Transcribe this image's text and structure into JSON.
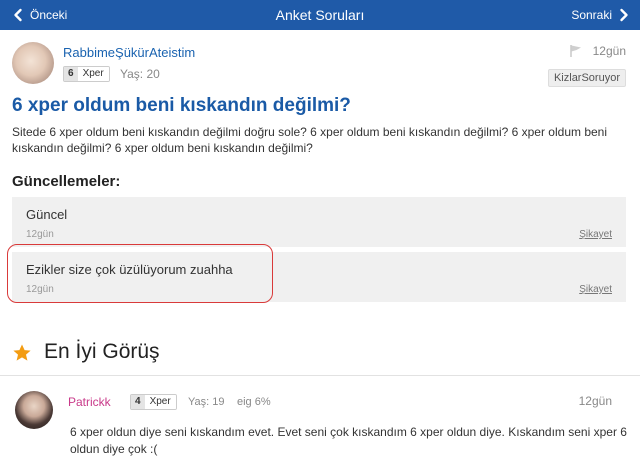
{
  "topbar": {
    "prev_label": "Önceki",
    "title": "Anket Soruları",
    "next_label": "Sonraki",
    "bg_color": "#1f5aa8"
  },
  "question": {
    "username": "RabbimeŞükürAteistim",
    "xper_level": "6",
    "xper_label": "Xper",
    "age": "Yaş: 20",
    "time": "12gün",
    "tag": "KizlarSoruyor",
    "title": "6 xper oldum beni kıskandın değilmi?",
    "body": "Sitede 6 xper oldum beni kıskandın değilmi doğru sole? 6 xper oldum beni kıskandın değilmi? 6 xper oldum beni kıskandın değilmi? 6 xper oldum beni kıskandın değilmi?"
  },
  "updates": {
    "heading": "Güncellemeler:",
    "items": [
      {
        "text": "Güncel",
        "time": "12gün",
        "report": "Şikayet"
      },
      {
        "text": "Ezikler size çok üzülüyorum zuahha",
        "time": "12gün",
        "report": "Şikayet"
      }
    ]
  },
  "best_opinion": {
    "heading": "En İyi Görüş",
    "star_color": "#f39c12",
    "username": "Patrickk",
    "xper_level": "4",
    "xper_label": "Xper",
    "age": "Yaş: 19",
    "eig": "eig 6%",
    "time": "12gün",
    "text": "6 xper oldun diye seni kıskandım evet. Evet seni çok kıskandım 6 xper oldun diye. Kıskandım seni xper 6 oldun diye çok :("
  },
  "icons": {
    "prev": "chevron-left-icon",
    "next": "chevron-right-icon",
    "flag": "flag-icon",
    "star": "star-icon"
  }
}
